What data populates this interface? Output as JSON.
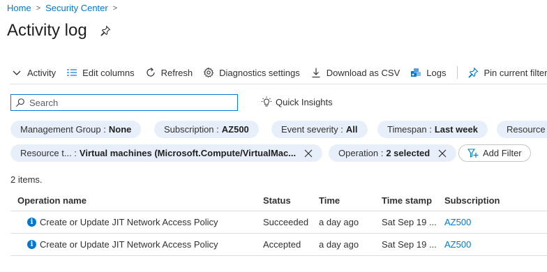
{
  "breadcrumb": {
    "home": "Home",
    "security_center": "Security Center"
  },
  "page": {
    "title": "Activity log"
  },
  "toolbar": {
    "activity": "Activity",
    "edit_columns": "Edit columns",
    "refresh": "Refresh",
    "diagnostics": "Diagnostics settings",
    "download_csv": "Download as CSV",
    "logs": "Logs",
    "pin_filters": "Pin current filters"
  },
  "search": {
    "placeholder": "Search",
    "value": ""
  },
  "quick_insights": "Quick Insights",
  "filters": {
    "management_group": {
      "label": "Management Group :",
      "value": "None"
    },
    "subscription": {
      "label": "Subscription :",
      "value": "AZ500"
    },
    "event_severity": {
      "label": "Event severity :",
      "value": "All"
    },
    "timespan": {
      "label": "Timespan :",
      "value": "Last week"
    },
    "resource_group": {
      "label": "Resource"
    },
    "resource_type": {
      "label": "Resource t... :",
      "value": "Virtual machines (Microsoft.Compute/VirtualMac..."
    },
    "operation": {
      "label": "Operation :",
      "value": "2 selected"
    },
    "add_filter": "Add Filter"
  },
  "results": {
    "count_text": "2 items."
  },
  "table": {
    "columns": {
      "operation": "Operation name",
      "status": "Status",
      "time": "Time",
      "timestamp": "Time stamp",
      "subscription": "Subscription"
    },
    "rows": [
      {
        "operation": "Create or Update JIT Network Access Policy",
        "status": "Succeeded",
        "time": "a day ago",
        "timestamp": "Sat Sep 19 ...",
        "subscription": "AZ500"
      },
      {
        "operation": "Create or Update JIT Network Access Policy",
        "status": "Accepted",
        "time": "a day ago",
        "timestamp": "Sat Sep 19 ...",
        "subscription": "AZ500"
      }
    ]
  },
  "colors": {
    "accent": "#0078d4",
    "pill_bg": "#e7f0fa",
    "text": "#323130"
  }
}
